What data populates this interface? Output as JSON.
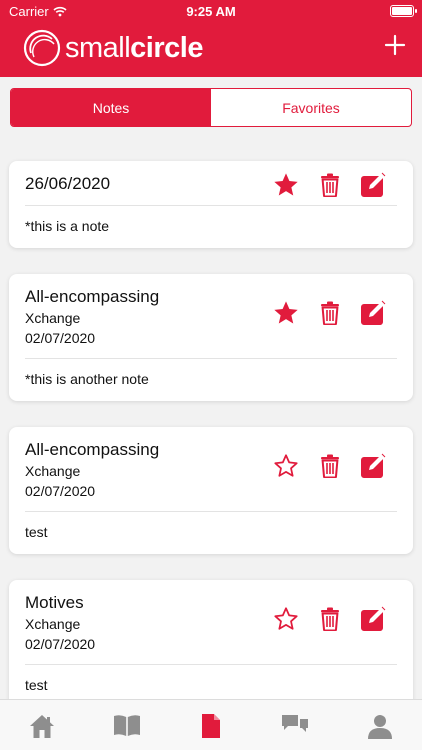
{
  "status_bar": {
    "carrier": "Carrier",
    "time": "9:25 AM"
  },
  "header": {
    "logo_text_light": "small",
    "logo_text_bold": "circle",
    "add_icon": "plus-icon"
  },
  "segments": {
    "notes": "Notes",
    "favorites": "Favorites"
  },
  "notes": [
    {
      "title": "26/06/2020",
      "subtitle": "",
      "date": "",
      "favorite": true,
      "text": "*this is a note"
    },
    {
      "title": "All-encompassing",
      "subtitle": "Xchange",
      "date": "02/07/2020",
      "favorite": true,
      "text": "*this is another note"
    },
    {
      "title": "All-encompassing",
      "subtitle": "Xchange",
      "date": "02/07/2020",
      "favorite": false,
      "text": "test"
    },
    {
      "title": "Motives",
      "subtitle": "Xchange",
      "date": "02/07/2020",
      "favorite": false,
      "text": "test"
    }
  ],
  "tabbar": [
    {
      "icon": "home-icon",
      "active": false
    },
    {
      "icon": "book-icon",
      "active": false
    },
    {
      "icon": "notes-icon",
      "active": true
    },
    {
      "icon": "chat-icon",
      "active": false
    },
    {
      "icon": "profile-icon",
      "active": false
    }
  ],
  "colors": {
    "accent": "#e11b3c",
    "inactive_icon": "#8e8e8e"
  }
}
